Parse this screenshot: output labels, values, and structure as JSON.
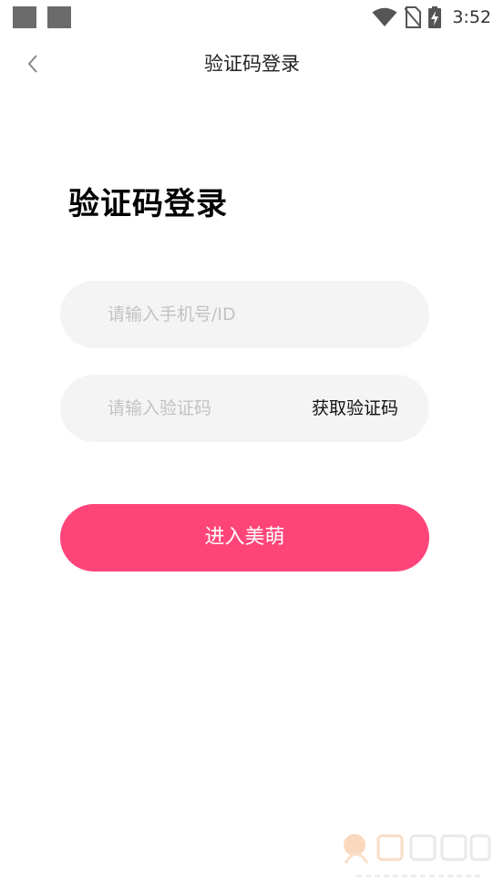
{
  "status_bar": {
    "time": "3:52",
    "icons": [
      "notification-square",
      "notification-square",
      "wifi-icon",
      "no-sim-icon",
      "battery-charging-icon"
    ]
  },
  "nav": {
    "back_icon": "chevron-left-icon",
    "title": "验证码登录"
  },
  "heading": "验证码登录",
  "phone_field": {
    "value": "",
    "placeholder": "请输入手机号/ID"
  },
  "code_field": {
    "value": "",
    "placeholder": "请输入验证码",
    "get_code_label": "获取验证码"
  },
  "submit_label": "进入美萌",
  "colors": {
    "accent": "#ff4479",
    "field_bg": "#f4f4f4",
    "placeholder": "#c2c2c2"
  }
}
